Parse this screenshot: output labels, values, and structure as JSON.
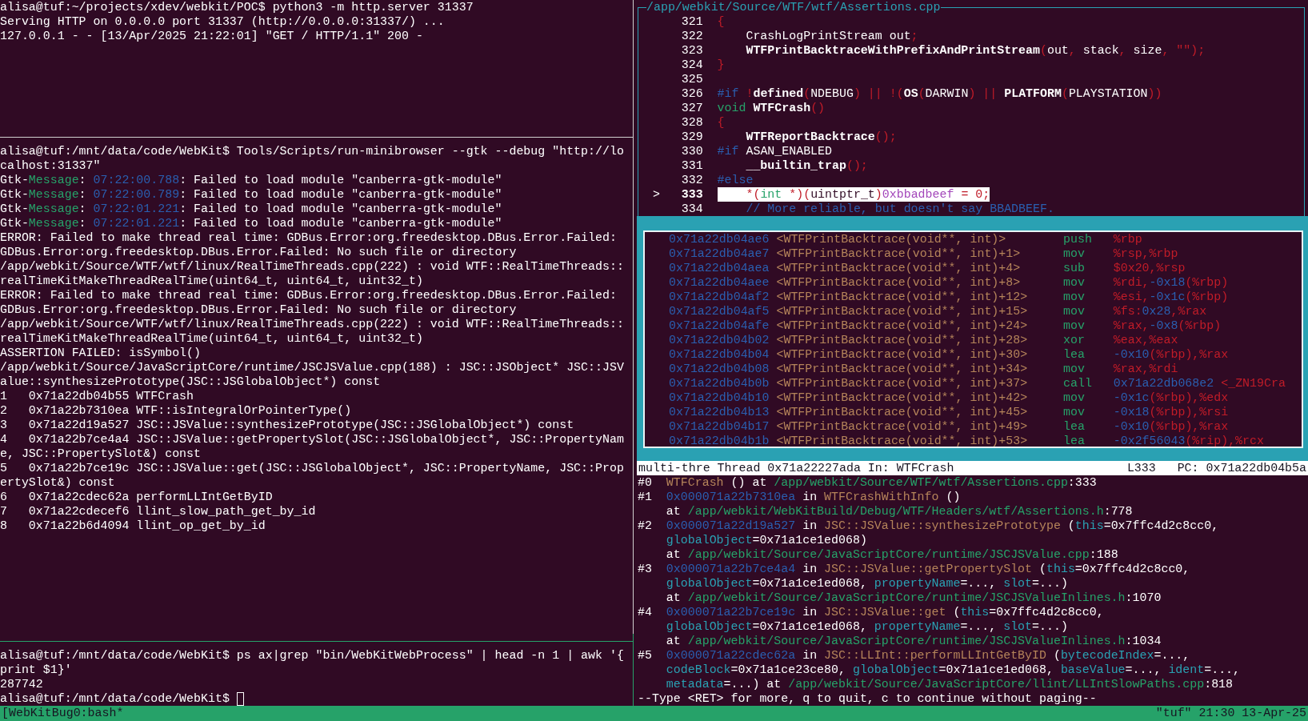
{
  "left_panes": [
    {
      "active": false,
      "cursor": false,
      "lines": [
        [
          {
            "kind": "plain",
            "text": "alisa@tuf:~/projects/xdev/webkit/POC$ python3 -m http.server 31337"
          }
        ],
        [
          {
            "kind": "plain",
            "text": "Serving HTTP on 0.0.0.0 port 31337 (http://0.0.0.0:31337/) ..."
          }
        ],
        [
          {
            "kind": "plain",
            "text": "127.0.0.1 - - [13/Apr/2025 21:22:01] \"GET / HTTP/1.1\" 200 -"
          }
        ]
      ]
    },
    {
      "active": false,
      "cursor": false,
      "lines": [
        [
          {
            "kind": "plain",
            "text": "alisa@tuf:/mnt/data/code/WebKit$ Tools/Scripts/run-minibrowser --gtk --debug \"http://lo"
          }
        ],
        [
          {
            "kind": "plain",
            "text": "calhost:31337\""
          }
        ],
        [
          {
            "kind": "plain",
            "text": "Gtk-"
          },
          {
            "kind": "green",
            "text": "Message"
          },
          {
            "kind": "plain",
            "text": ": "
          },
          {
            "kind": "blue",
            "text": "07:22:00.788"
          },
          {
            "kind": "plain",
            "text": ": Failed to load module \"canberra-gtk-module\""
          }
        ],
        [
          {
            "kind": "plain",
            "text": "Gtk-"
          },
          {
            "kind": "green",
            "text": "Message"
          },
          {
            "kind": "plain",
            "text": ": "
          },
          {
            "kind": "blue",
            "text": "07:22:00.789"
          },
          {
            "kind": "plain",
            "text": ": Failed to load module \"canberra-gtk-module\""
          }
        ],
        [
          {
            "kind": "plain",
            "text": "Gtk-"
          },
          {
            "kind": "green",
            "text": "Message"
          },
          {
            "kind": "plain",
            "text": ": "
          },
          {
            "kind": "blue",
            "text": "07:22:01.221"
          },
          {
            "kind": "plain",
            "text": ": Failed to load module \"canberra-gtk-module\""
          }
        ],
        [
          {
            "kind": "plain",
            "text": "Gtk-"
          },
          {
            "kind": "green",
            "text": "Message"
          },
          {
            "kind": "plain",
            "text": ": "
          },
          {
            "kind": "blue",
            "text": "07:22:01.221"
          },
          {
            "kind": "plain",
            "text": ": Failed to load module \"canberra-gtk-module\""
          }
        ],
        [
          {
            "kind": "plain",
            "text": "ERROR: Failed to make thread real time: GDBus.Error:org.freedesktop.DBus.Error.Failed:"
          }
        ],
        [
          {
            "kind": "plain",
            "text": "GDBus.Error:org.freedesktop.DBus.Error.Failed: No such file or directory"
          }
        ],
        [
          {
            "kind": "plain",
            "text": "/app/webkit/Source/WTF/wtf/linux/RealTimeThreads.cpp(222) : void WTF::RealTimeThreads::"
          }
        ],
        [
          {
            "kind": "plain",
            "text": "realTimeKitMakeThreadRealTime(uint64_t, uint64_t, uint32_t)"
          }
        ],
        [
          {
            "kind": "plain",
            "text": "ERROR: Failed to make thread real time: GDBus.Error:org.freedesktop.DBus.Error.Failed:"
          }
        ],
        [
          {
            "kind": "plain",
            "text": "GDBus.Error:org.freedesktop.DBus.Error.Failed: No such file or directory"
          }
        ],
        [
          {
            "kind": "plain",
            "text": "/app/webkit/Source/WTF/wtf/linux/RealTimeThreads.cpp(222) : void WTF::RealTimeThreads::"
          }
        ],
        [
          {
            "kind": "plain",
            "text": "realTimeKitMakeThreadRealTime(uint64_t, uint64_t, uint32_t)"
          }
        ],
        [
          {
            "kind": "plain",
            "text": "ASSERTION FAILED: isSymbol()"
          }
        ],
        [
          {
            "kind": "plain",
            "text": "/app/webkit/Source/JavaScriptCore/runtime/JSCJSValue.cpp(188) : JSC::JSObject* JSC::JSV"
          }
        ],
        [
          {
            "kind": "plain",
            "text": "alue::synthesizePrototype(JSC::JSGlobalObject*) const"
          }
        ],
        [
          {
            "kind": "plain",
            "text": "1   0x71a22db04b55 WTFCrash"
          }
        ],
        [
          {
            "kind": "plain",
            "text": "2   0x71a22b7310ea WTF::isIntegralOrPointerType()"
          }
        ],
        [
          {
            "kind": "plain",
            "text": "3   0x71a22d19a527 JSC::JSValue::synthesizePrototype(JSC::JSGlobalObject*) const"
          }
        ],
        [
          {
            "kind": "plain",
            "text": "4   0x71a22b7ce4a4 JSC::JSValue::getPropertySlot(JSC::JSGlobalObject*, JSC::PropertyNam"
          }
        ],
        [
          {
            "kind": "plain",
            "text": "e, JSC::PropertySlot&) const"
          }
        ],
        [
          {
            "kind": "plain",
            "text": "5   0x71a22b7ce19c JSC::JSValue::get(JSC::JSGlobalObject*, JSC::PropertyName, JSC::Prop"
          }
        ],
        [
          {
            "kind": "plain",
            "text": "ertySlot&) const"
          }
        ],
        [
          {
            "kind": "plain",
            "text": "6   0x71a22cdec62a performLLIntGetByID"
          }
        ],
        [
          {
            "kind": "plain",
            "text": "7   0x71a22cdecef6 llint_slow_path_get_by_id"
          }
        ],
        [
          {
            "kind": "plain",
            "text": "8   0x71a22b6d4094 llint_op_get_by_id"
          }
        ]
      ]
    },
    {
      "active": true,
      "cursor": true,
      "lines": [
        [
          {
            "kind": "plain",
            "text": "alisa@tuf:/mnt/data/code/WebKit$ ps ax|grep \"bin/WebKitWebProcess\" | head -n 1 | awk '{"
          }
        ],
        [
          {
            "kind": "plain",
            "text": "print $1}'"
          }
        ],
        [
          {
            "kind": "plain",
            "text": "287742"
          }
        ],
        [
          {
            "kind": "plain",
            "text": "alisa@tuf:/mnt/data/code/WebKit$"
          }
        ]
      ]
    }
  ],
  "source": {
    "title": "/app/webkit/Source/WTF/wtf/Assertions.cpp",
    "lines": [
      {
        "number": "321",
        "selected": false,
        "segments": [
          {
            "kind": "red",
            "text": "{"
          }
        ]
      },
      {
        "number": "322",
        "selected": false,
        "segments": [
          {
            "kind": "plain",
            "text": "    CrashLogPrintStream out"
          },
          {
            "kind": "red",
            "text": ";"
          }
        ]
      },
      {
        "number": "323",
        "selected": false,
        "segments": [
          {
            "kind": "bold",
            "text": "    WTFPrintBacktraceWithPrefixAndPrintStream"
          },
          {
            "kind": "red",
            "text": "("
          },
          {
            "kind": "plain",
            "text": "out"
          },
          {
            "kind": "red",
            "text": ", "
          },
          {
            "kind": "plain",
            "text": "stack"
          },
          {
            "kind": "red",
            "text": ", "
          },
          {
            "kind": "plain",
            "text": "size"
          },
          {
            "kind": "red",
            "text": ", \"\");"
          }
        ]
      },
      {
        "number": "324",
        "selected": false,
        "segments": [
          {
            "kind": "red",
            "text": "}"
          }
        ]
      },
      {
        "number": "325",
        "selected": false
      },
      {
        "number": "326",
        "selected": false,
        "segments": [
          {
            "kind": "blue",
            "text": "#if"
          },
          {
            "kind": "red",
            "text": " !"
          },
          {
            "kind": "bold",
            "text": "defined"
          },
          {
            "kind": "red",
            "text": "("
          },
          {
            "kind": "plain",
            "text": "NDEBUG"
          },
          {
            "kind": "red",
            "text": ") || !("
          },
          {
            "kind": "bold",
            "text": "OS"
          },
          {
            "kind": "red",
            "text": "("
          },
          {
            "kind": "plain",
            "text": "DARWIN"
          },
          {
            "kind": "red",
            "text": ") || "
          },
          {
            "kind": "bold",
            "text": "PLATFORM"
          },
          {
            "kind": "red",
            "text": "("
          },
          {
            "kind": "plain",
            "text": "PLAYSTATION"
          },
          {
            "kind": "red",
            "text": "))"
          }
        ]
      },
      {
        "number": "327",
        "selected": false,
        "segments": [
          {
            "kind": "green",
            "text": "void"
          },
          {
            "kind": "bold",
            "text": " WTFCrash"
          },
          {
            "kind": "red",
            "text": "()"
          }
        ]
      },
      {
        "number": "328",
        "selected": false,
        "segments": [
          {
            "kind": "red",
            "text": "{"
          }
        ]
      },
      {
        "number": "329",
        "selected": false,
        "segments": [
          {
            "kind": "bold",
            "text": "    WTFReportBacktrace"
          },
          {
            "kind": "red",
            "text": "();"
          }
        ]
      },
      {
        "number": "330",
        "selected": false,
        "segments": [
          {
            "kind": "blue",
            "text": "#if"
          },
          {
            "kind": "plain",
            "text": " ASAN_ENABLED"
          }
        ]
      },
      {
        "number": "331",
        "selected": false,
        "segments": [
          {
            "kind": "bold",
            "text": "    __builtin_trap"
          },
          {
            "kind": "red",
            "text": "();"
          }
        ]
      },
      {
        "number": "332",
        "selected": false,
        "segments": [
          {
            "kind": "blue",
            "text": "#else"
          }
        ]
      },
      {
        "number": "333",
        "selected": true,
        "marker": ">",
        "segments": [
          {
            "kind": "red",
            "text": "    *("
          },
          {
            "kind": "green",
            "text": "int"
          },
          {
            "kind": "red",
            "text": " *)("
          },
          {
            "kind": "dark",
            "text": "uintptr_t"
          },
          {
            "kind": "red",
            "text": ")"
          },
          {
            "kind": "magenta",
            "text": "0xbbadbeef"
          },
          {
            "kind": "red",
            "text": " = 0;"
          }
        ]
      },
      {
        "number": "334",
        "selected": false,
        "segments": [
          {
            "kind": "blue",
            "text": "    // More reliable, but doesn't say BBADBEEF."
          }
        ]
      }
    ]
  },
  "disassembly": [
    {
      "address": "0x71a22db04ae6",
      "symbol": "<WTFPrintBacktrace(void**, int)>",
      "mnemonic": "push",
      "operands": [
        {
          "kind": "red",
          "text": "%rbp"
        }
      ]
    },
    {
      "address": "0x71a22db04ae7",
      "symbol": "<WTFPrintBacktrace(void**, int)+1>",
      "mnemonic": "mov",
      "operands": [
        {
          "kind": "red",
          "text": "%rsp,%rbp"
        }
      ]
    },
    {
      "address": "0x71a22db04aea",
      "symbol": "<WTFPrintBacktrace(void**, int)+4>",
      "mnemonic": "sub",
      "operands": [
        {
          "kind": "red",
          "text": "$0x20,%rsp"
        }
      ]
    },
    {
      "address": "0x71a22db04aee",
      "symbol": "<WTFPrintBacktrace(void**, int)+8>",
      "mnemonic": "mov",
      "operands": [
        {
          "kind": "red",
          "text": "%rdi,"
        },
        {
          "kind": "blue",
          "text": "-0x18"
        },
        {
          "kind": "red",
          "text": "(%rbp)"
        }
      ]
    },
    {
      "address": "0x71a22db04af2",
      "symbol": "<WTFPrintBacktrace(void**, int)+12>",
      "mnemonic": "mov",
      "operands": [
        {
          "kind": "red",
          "text": "%esi,"
        },
        {
          "kind": "blue",
          "text": "-0x1c"
        },
        {
          "kind": "red",
          "text": "(%rbp)"
        }
      ]
    },
    {
      "address": "0x71a22db04af5",
      "symbol": "<WTFPrintBacktrace(void**, int)+15>",
      "mnemonic": "mov",
      "operands": [
        {
          "kind": "red",
          "text": "%fs:"
        },
        {
          "kind": "blue",
          "text": "0x28"
        },
        {
          "kind": "red",
          "text": ",%rax"
        }
      ]
    },
    {
      "address": "0x71a22db04afe",
      "symbol": "<WTFPrintBacktrace(void**, int)+24>",
      "mnemonic": "mov",
      "operands": [
        {
          "kind": "red",
          "text": "%rax,"
        },
        {
          "kind": "blue",
          "text": "-0x8"
        },
        {
          "kind": "red",
          "text": "(%rbp)"
        }
      ]
    },
    {
      "address": "0x71a22db04b02",
      "symbol": "<WTFPrintBacktrace(void**, int)+28>",
      "mnemonic": "xor",
      "operands": [
        {
          "kind": "red",
          "text": "%eax,%eax"
        }
      ]
    },
    {
      "address": "0x71a22db04b04",
      "symbol": "<WTFPrintBacktrace(void**, int)+30>",
      "mnemonic": "lea",
      "operands": [
        {
          "kind": "blue",
          "text": "-0x10"
        },
        {
          "kind": "red",
          "text": "(%rbp),%rax"
        }
      ]
    },
    {
      "address": "0x71a22db04b08",
      "symbol": "<WTFPrintBacktrace(void**, int)+34>",
      "mnemonic": "mov",
      "operands": [
        {
          "kind": "red",
          "text": "%rax,%rdi"
        }
      ]
    },
    {
      "address": "0x71a22db04b0b",
      "symbol": "<WTFPrintBacktrace(void**, int)+37>",
      "mnemonic": "call",
      "operands": [
        {
          "kind": "blue",
          "text": "0x71a22db068e2"
        },
        {
          "kind": "red",
          "text": " <_ZN19Cra"
        }
      ]
    },
    {
      "address": "0x71a22db04b10",
      "symbol": "<WTFPrintBacktrace(void**, int)+42>",
      "mnemonic": "mov",
      "operands": [
        {
          "kind": "blue",
          "text": "-0x1c"
        },
        {
          "kind": "red",
          "text": "(%rbp),%edx"
        }
      ]
    },
    {
      "address": "0x71a22db04b13",
      "symbol": "<WTFPrintBacktrace(void**, int)+45>",
      "mnemonic": "mov",
      "operands": [
        {
          "kind": "blue",
          "text": "-0x18"
        },
        {
          "kind": "red",
          "text": "(%rbp),%rsi"
        }
      ]
    },
    {
      "address": "0x71a22db04b17",
      "symbol": "<WTFPrintBacktrace(void**, int)+49>",
      "mnemonic": "lea",
      "operands": [
        {
          "kind": "blue",
          "text": "-0x10"
        },
        {
          "kind": "red",
          "text": "(%rbp),%rax"
        }
      ]
    },
    {
      "address": "0x71a22db04b1b",
      "symbol": "<WTFPrintBacktrace(void**, int)+53>",
      "mnemonic": "lea",
      "operands": [
        {
          "kind": "blue",
          "text": "-0x2f56043"
        },
        {
          "kind": "red",
          "text": "(%rip),%rcx"
        }
      ]
    }
  ],
  "gdb_status": {
    "thread": "multi-thre Thread 0x71a22227ada In: WTFCrash",
    "line": "L333",
    "pc": "PC: 0x71a22db04b5a"
  },
  "backtrace": [
    {
      "kind": "frame",
      "segments": [
        {
          "kind": "plain",
          "text": "#0  "
        },
        {
          "kind": "brown",
          "text": "WTFCrash"
        },
        {
          "kind": "plain",
          "text": " () at "
        },
        {
          "kind": "green",
          "text": "/app/webkit/Source/WTF/wtf/Assertions.cpp"
        },
        {
          "kind": "plain",
          "text": ":333"
        }
      ]
    },
    {
      "kind": "frame",
      "segments": [
        {
          "kind": "plain",
          "text": "#1  "
        },
        {
          "kind": "blue",
          "text": "0x000071a22b7310ea"
        },
        {
          "kind": "plain",
          "text": " in "
        },
        {
          "kind": "brown",
          "text": "WTFCrashWithInfo"
        },
        {
          "kind": "plain",
          "text": " ()"
        }
      ]
    },
    {
      "kind": "continuation",
      "segments": [
        {
          "kind": "plain",
          "text": "at "
        },
        {
          "kind": "green",
          "text": "/app/webkit/WebKitBuild/Debug/WTF/Headers/wtf/Assertions.h"
        },
        {
          "kind": "plain",
          "text": ":778"
        }
      ]
    },
    {
      "kind": "frame",
      "segments": [
        {
          "kind": "plain",
          "text": "#2  "
        },
        {
          "kind": "blue",
          "text": "0x000071a22d19a527"
        },
        {
          "kind": "plain",
          "text": " in "
        },
        {
          "kind": "brown",
          "text": "JSC::JSValue::synthesizePrototype"
        },
        {
          "kind": "plain",
          "text": " ("
        },
        {
          "kind": "cyan",
          "text": "this"
        },
        {
          "kind": "plain",
          "text": "=0x7ffc4d2c8cc0,"
        }
      ]
    },
    {
      "kind": "continuation",
      "segments": [
        {
          "kind": "cyan",
          "text": "globalObject"
        },
        {
          "kind": "plain",
          "text": "=0x71a1ce1ed068)"
        }
      ]
    },
    {
      "kind": "continuation",
      "segments": [
        {
          "kind": "plain",
          "text": "at "
        },
        {
          "kind": "green",
          "text": "/app/webkit/Source/JavaScriptCore/runtime/JSCJSValue.cpp"
        },
        {
          "kind": "plain",
          "text": ":188"
        }
      ]
    },
    {
      "kind": "frame",
      "segments": [
        {
          "kind": "plain",
          "text": "#3  "
        },
        {
          "kind": "blue",
          "text": "0x000071a22b7ce4a4"
        },
        {
          "kind": "plain",
          "text": " in "
        },
        {
          "kind": "brown",
          "text": "JSC::JSValue::getPropertySlot"
        },
        {
          "kind": "plain",
          "text": " ("
        },
        {
          "kind": "cyan",
          "text": "this"
        },
        {
          "kind": "plain",
          "text": "=0x7ffc4d2c8cc0,"
        }
      ]
    },
    {
      "kind": "continuation",
      "segments": [
        {
          "kind": "cyan",
          "text": "globalObject"
        },
        {
          "kind": "plain",
          "text": "=0x71a1ce1ed068, "
        },
        {
          "kind": "cyan",
          "text": "propertyName"
        },
        {
          "kind": "plain",
          "text": "=..., "
        },
        {
          "kind": "cyan",
          "text": "slot"
        },
        {
          "kind": "plain",
          "text": "=...)"
        }
      ]
    },
    {
      "kind": "continuation",
      "segments": [
        {
          "kind": "plain",
          "text": "at "
        },
        {
          "kind": "green",
          "text": "/app/webkit/Source/JavaScriptCore/runtime/JSCJSValueInlines.h"
        },
        {
          "kind": "plain",
          "text": ":1070"
        }
      ]
    },
    {
      "kind": "frame",
      "segments": [
        {
          "kind": "plain",
          "text": "#4  "
        },
        {
          "kind": "blue",
          "text": "0x000071a22b7ce19c"
        },
        {
          "kind": "plain",
          "text": " in "
        },
        {
          "kind": "brown",
          "text": "JSC::JSValue::get"
        },
        {
          "kind": "plain",
          "text": " ("
        },
        {
          "kind": "cyan",
          "text": "this"
        },
        {
          "kind": "plain",
          "text": "=0x7ffc4d2c8cc0,"
        }
      ]
    },
    {
      "kind": "continuation",
      "segments": [
        {
          "kind": "cyan",
          "text": "globalObject"
        },
        {
          "kind": "plain",
          "text": "=0x71a1ce1ed068, "
        },
        {
          "kind": "cyan",
          "text": "propertyName"
        },
        {
          "kind": "plain",
          "text": "=..., "
        },
        {
          "kind": "cyan",
          "text": "slot"
        },
        {
          "kind": "plain",
          "text": "=...)"
        }
      ]
    },
    {
      "kind": "continuation",
      "segments": [
        {
          "kind": "plain",
          "text": "at "
        },
        {
          "kind": "green",
          "text": "/app/webkit/Source/JavaScriptCore/runtime/JSCJSValueInlines.h"
        },
        {
          "kind": "plain",
          "text": ":1034"
        }
      ]
    },
    {
      "kind": "frame",
      "segments": [
        {
          "kind": "plain",
          "text": "#5  "
        },
        {
          "kind": "blue",
          "text": "0x000071a22cdec62a"
        },
        {
          "kind": "plain",
          "text": " in "
        },
        {
          "kind": "brown",
          "text": "JSC::LLInt::performLLIntGetByID"
        },
        {
          "kind": "plain",
          "text": " ("
        },
        {
          "kind": "cyan",
          "text": "bytecodeIndex"
        },
        {
          "kind": "plain",
          "text": "=...,"
        }
      ]
    },
    {
      "kind": "continuation",
      "segments": [
        {
          "kind": "cyan",
          "text": "codeBlock"
        },
        {
          "kind": "plain",
          "text": "=0x71a1ce23ce80, "
        },
        {
          "kind": "cyan",
          "text": "globalObject"
        },
        {
          "kind": "plain",
          "text": "=0x71a1ce1ed068, "
        },
        {
          "kind": "cyan",
          "text": "baseValue"
        },
        {
          "kind": "plain",
          "text": "=..., "
        },
        {
          "kind": "cyan",
          "text": "ident"
        },
        {
          "kind": "plain",
          "text": "=...,"
        }
      ]
    },
    {
      "kind": "continuation",
      "segments": [
        {
          "kind": "cyan",
          "text": "metadata"
        },
        {
          "kind": "plain",
          "text": "=...) at "
        },
        {
          "kind": "green",
          "text": "/app/webkit/Source/JavaScriptCore/llint/LLIntSlowPaths.cpp"
        },
        {
          "kind": "plain",
          "text": ":818"
        }
      ]
    },
    {
      "kind": "frame",
      "segments": [
        {
          "kind": "plain",
          "text": "--Type <RET> for more, q to quit, c to continue without paging--"
        }
      ]
    }
  ],
  "tmux_status": {
    "session": "[WebKitBug0:bash*",
    "host_time": "\"tuf\" 21:30 13-Apr-25"
  }
}
